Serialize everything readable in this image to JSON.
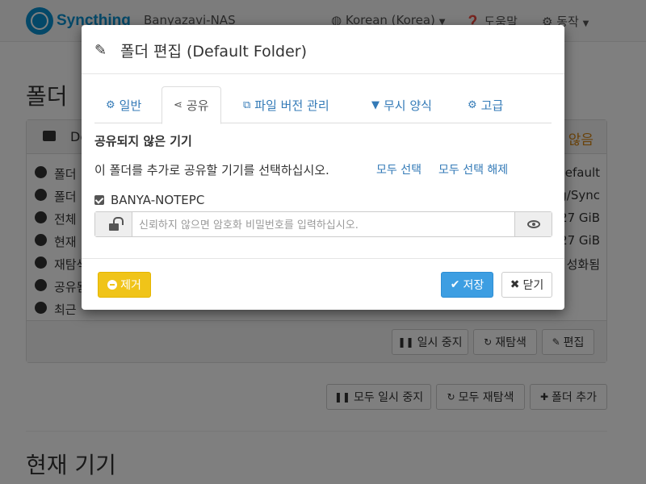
{
  "navbar": {
    "brand": "Syncthing",
    "device_name": "Banyazavi-NAS",
    "language": "Korean (Korea)",
    "help": "도움말",
    "actions": "동작"
  },
  "background": {
    "folders_title": "폴더",
    "folder_label": "De",
    "folder_status": "않음",
    "rows": [
      {
        "label": "폴더",
        "value": "default"
      },
      {
        "label": "폴더",
        "value": "g/Sync"
      },
      {
        "label": "전체",
        "value": "27 GiB"
      },
      {
        "label": "현재",
        "value": "27 GiB"
      },
      {
        "label": "재탐색",
        "value": "성화됨"
      },
      {
        "label": "공유됨",
        "value": ""
      },
      {
        "label": "최근",
        "value": ""
      }
    ],
    "pause": "일시 중지",
    "rescan": "재탐색",
    "edit": "편집",
    "pause_all": "모두 일시 중지",
    "rescan_all": "모두 재탐색",
    "add_folder": "폴더 추가",
    "this_device_title": "현재 기기"
  },
  "modal": {
    "title": "폴더 편집 (Default Folder)",
    "tabs": [
      {
        "label": "일반",
        "icon": "gear-icon"
      },
      {
        "label": "공유",
        "icon": "share-icon"
      },
      {
        "label": "파일 버전 관리",
        "icon": "copy-icon"
      },
      {
        "label": "무시 양식",
        "icon": "filter-icon"
      },
      {
        "label": "고급",
        "icon": "cogs-icon"
      }
    ],
    "active_tab": "공유",
    "unshared_heading": "공유되지 않은 기기",
    "help_text": "이 폴더를 추가로 공유할 기기를 선택하십시오.",
    "select_all": "모두 선택",
    "deselect_all": "모두 선택 해제",
    "device": {
      "name": "BANYA-NOTEPC",
      "checked": true
    },
    "password_placeholder": "신뢰하지 않으면 암호화 비밀번호를 입력하십시오.",
    "remove": "제거",
    "save": "저장",
    "close": "닫기"
  },
  "colors": {
    "accent": "#337ab7",
    "primary_btn": "#3d9ee2",
    "warning_btn": "#f0c419"
  }
}
